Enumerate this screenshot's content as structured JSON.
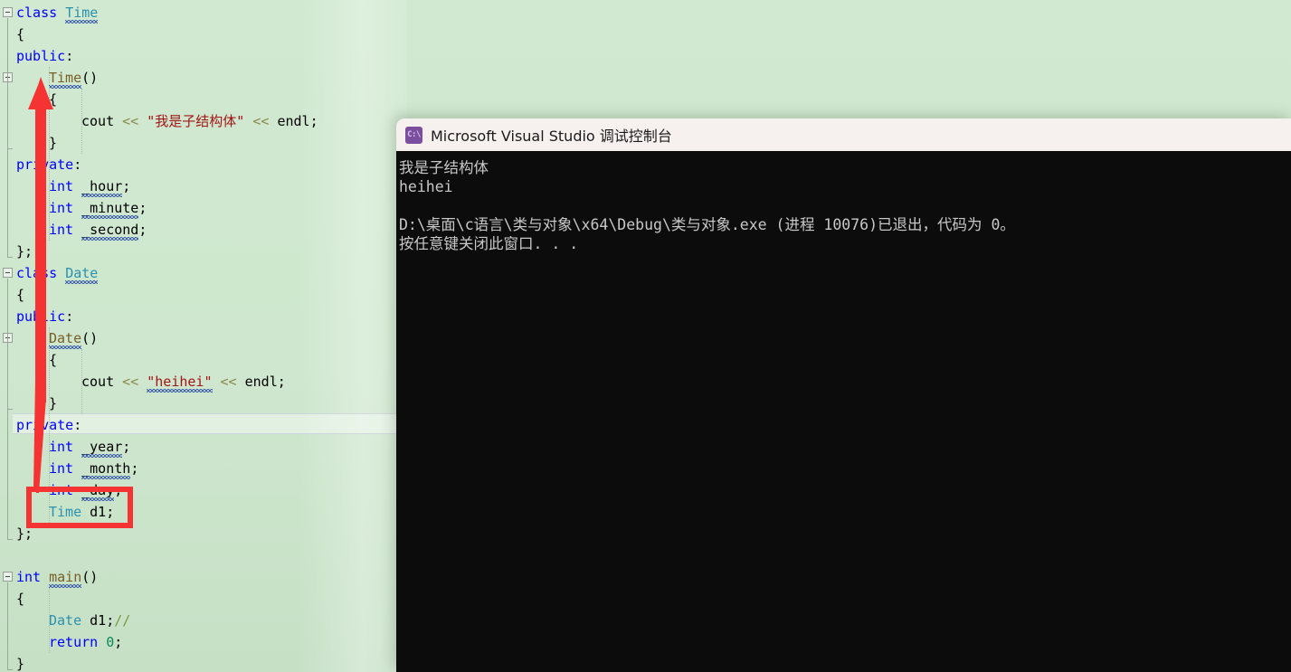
{
  "editor": {
    "name": "visual-studio-code-editor",
    "background_color": "#cfe8cf",
    "current_line_index": 15,
    "lines": [
      {
        "indent": 0,
        "fold": "open",
        "tokens": [
          {
            "t": "class ",
            "c": "key"
          },
          {
            "t": "Time",
            "c": "type",
            "squiggle": true
          }
        ]
      },
      {
        "indent": 0,
        "fold": "none",
        "tokens": [
          {
            "t": "{",
            "c": "punct"
          }
        ]
      },
      {
        "indent": 0,
        "fold": "none",
        "tokens": [
          {
            "t": "public",
            "c": "key"
          },
          {
            "t": ":",
            "c": "punct"
          }
        ]
      },
      {
        "indent": 1,
        "fold": "open",
        "tokens": [
          {
            "t": "Time",
            "c": "fn",
            "squiggle": true
          },
          {
            "t": "()",
            "c": "punct"
          }
        ]
      },
      {
        "indent": 1,
        "fold": "none",
        "tokens": [
          {
            "t": "{",
            "c": "punct"
          }
        ]
      },
      {
        "indent": 2,
        "fold": "none",
        "tokens": [
          {
            "t": "cout ",
            "c": "id"
          },
          {
            "t": "<< ",
            "c": "op"
          },
          {
            "t": "\"我是子结构体\"",
            "c": "str"
          },
          {
            "t": " << ",
            "c": "op"
          },
          {
            "t": "endl",
            "c": "id"
          },
          {
            "t": ";",
            "c": "punct"
          }
        ]
      },
      {
        "indent": 1,
        "fold": "none",
        "tokens": [
          {
            "t": "}",
            "c": "punct"
          }
        ]
      },
      {
        "indent": 0,
        "fold": "end",
        "tokens": [
          {
            "t": "private",
            "c": "key"
          },
          {
            "t": ":",
            "c": "punct"
          }
        ]
      },
      {
        "indent": 1,
        "fold": "none",
        "tokens": [
          {
            "t": "int ",
            "c": "key"
          },
          {
            "t": "_hour",
            "c": "id",
            "squiggle": true
          },
          {
            "t": ";",
            "c": "punct"
          }
        ]
      },
      {
        "indent": 1,
        "fold": "none",
        "tokens": [
          {
            "t": "int ",
            "c": "key"
          },
          {
            "t": "_minute",
            "c": "id",
            "squiggle": true
          },
          {
            "t": ";",
            "c": "punct"
          }
        ]
      },
      {
        "indent": 1,
        "fold": "none",
        "tokens": [
          {
            "t": "int ",
            "c": "key"
          },
          {
            "t": "_second",
            "c": "id",
            "squiggle": true
          },
          {
            "t": ";",
            "c": "punct"
          }
        ]
      },
      {
        "indent": 0,
        "fold": "none",
        "tokens": [
          {
            "t": "};",
            "c": "punct"
          }
        ]
      },
      {
        "indent": 0,
        "fold": "open",
        "tokens": [
          {
            "t": "class ",
            "c": "key"
          },
          {
            "t": "Date",
            "c": "type",
            "squiggle": true
          }
        ]
      },
      {
        "indent": 0,
        "fold": "none",
        "tokens": [
          {
            "t": "{",
            "c": "punct"
          }
        ]
      },
      {
        "indent": 0,
        "fold": "none",
        "tokens": [
          {
            "t": "public",
            "c": "key"
          },
          {
            "t": ":",
            "c": "punct"
          }
        ]
      },
      {
        "indent": 1,
        "fold": "open",
        "tokens": [
          {
            "t": "Date",
            "c": "fn",
            "squiggle": true
          },
          {
            "t": "()",
            "c": "punct"
          }
        ]
      },
      {
        "indent": 1,
        "fold": "none",
        "tokens": [
          {
            "t": "{",
            "c": "punct"
          }
        ]
      },
      {
        "indent": 2,
        "fold": "none",
        "tokens": [
          {
            "t": "cout ",
            "c": "id"
          },
          {
            "t": "<< ",
            "c": "op"
          },
          {
            "t": "\"heihei\"",
            "c": "str",
            "squiggle": true
          },
          {
            "t": " << ",
            "c": "op"
          },
          {
            "t": "endl",
            "c": "id"
          },
          {
            "t": ";",
            "c": "punct"
          }
        ]
      },
      {
        "indent": 1,
        "fold": "none",
        "tokens": [
          {
            "t": "}",
            "c": "punct"
          }
        ]
      },
      {
        "indent": 0,
        "fold": "end",
        "tokens": [
          {
            "t": "private",
            "c": "key"
          },
          {
            "t": ":",
            "c": "punct"
          }
        ]
      },
      {
        "indent": 1,
        "fold": "none",
        "tokens": [
          {
            "t": "int ",
            "c": "key"
          },
          {
            "t": "_year",
            "c": "id",
            "squiggle": true
          },
          {
            "t": ";",
            "c": "punct"
          }
        ]
      },
      {
        "indent": 1,
        "fold": "none",
        "tokens": [
          {
            "t": "int ",
            "c": "key"
          },
          {
            "t": "_month",
            "c": "id",
            "squiggle": true
          },
          {
            "t": ";",
            "c": "punct"
          }
        ]
      },
      {
        "indent": 1,
        "fold": "none",
        "tokens": [
          {
            "t": "int ",
            "c": "key"
          },
          {
            "t": "_day",
            "c": "id",
            "squiggle": true
          },
          {
            "t": ";",
            "c": "punct"
          }
        ]
      },
      {
        "indent": 1,
        "fold": "none",
        "tokens": [
          {
            "t": "Time ",
            "c": "type"
          },
          {
            "t": "d1",
            "c": "id"
          },
          {
            "t": ";",
            "c": "punct"
          }
        ]
      },
      {
        "indent": 0,
        "fold": "none",
        "tokens": [
          {
            "t": "};",
            "c": "punct"
          }
        ]
      },
      {
        "indent": 0,
        "fold": "none",
        "tokens": []
      },
      {
        "indent": 0,
        "fold": "open",
        "tokens": [
          {
            "t": "int ",
            "c": "key"
          },
          {
            "t": "main",
            "c": "fn",
            "squiggle": true
          },
          {
            "t": "()",
            "c": "punct"
          }
        ]
      },
      {
        "indent": 0,
        "fold": "none",
        "tokens": [
          {
            "t": "{",
            "c": "punct"
          }
        ]
      },
      {
        "indent": 1,
        "fold": "none",
        "tokens": [
          {
            "t": "Date ",
            "c": "type"
          },
          {
            "t": "d1",
            "c": "id"
          },
          {
            "t": ";",
            "c": "punct"
          },
          {
            "t": "//",
            "c": "cmt"
          }
        ]
      },
      {
        "indent": 1,
        "fold": "none",
        "tokens": [
          {
            "t": "return ",
            "c": "key"
          },
          {
            "t": "0",
            "c": "num"
          },
          {
            "t": ";",
            "c": "punct"
          }
        ]
      },
      {
        "indent": 0,
        "fold": "none",
        "tokens": [
          {
            "t": "}",
            "c": "punct"
          }
        ]
      }
    ]
  },
  "annotations": {
    "arrow": {
      "name": "red-up-arrow",
      "color": "#f53333",
      "points_from": "Time d1; member declaration",
      "points_to": "Time() constructor"
    },
    "highlight_box": {
      "name": "red-highlight-box",
      "color": "#f53333",
      "target_text": "Time d1;"
    }
  },
  "console": {
    "title": "Microsoft Visual Studio 调试控制台",
    "icon": "console-window-icon",
    "icon_glyph": "C:\\",
    "titlebar_color": "#f6f0ef",
    "background_color": "#0c0c0c",
    "text_color": "#c8c8c8",
    "lines": [
      "我是子结构体",
      "heihei",
      "",
      "D:\\桌面\\c语言\\类与对象\\x64\\Debug\\类与对象.exe (进程 10076)已退出，代码为 0。",
      "按任意键关闭此窗口. . ."
    ]
  }
}
